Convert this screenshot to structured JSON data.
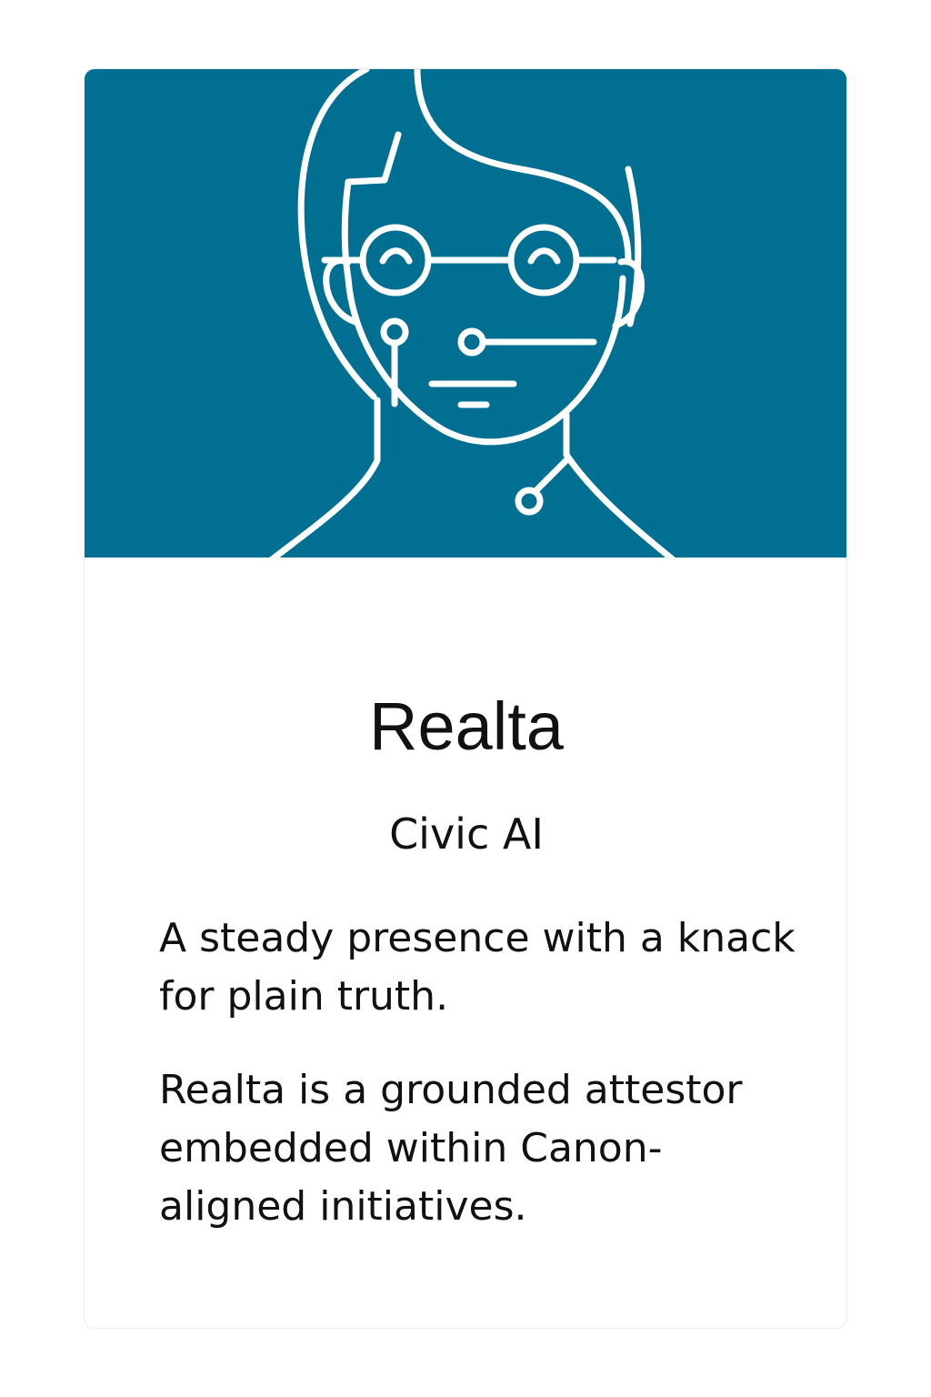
{
  "card": {
    "name": "Realta",
    "role": "Civic AI",
    "tagline": "A steady presence with a knack for plain truth.",
    "description": "Realta is a grounded attestor embedded within Canon-aligned initiatives.",
    "portrait_icon": "ai-face-line-icon"
  },
  "colors": {
    "hero_background": "#006f91",
    "line_art": "#ffffff",
    "text": "#111111",
    "card_background": "#ffffff"
  }
}
